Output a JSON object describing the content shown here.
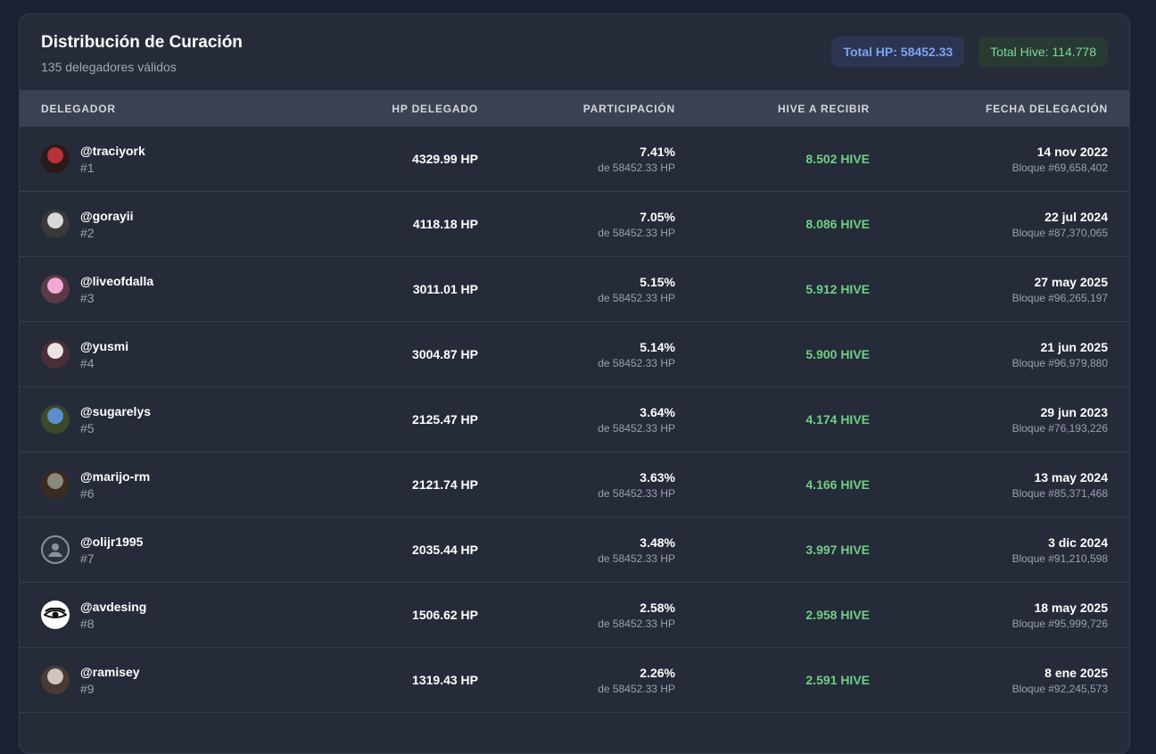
{
  "header": {
    "title": "Distribución de Curación",
    "subtitle": "135 delegadores válidos",
    "total_hp": "Total HP: 58452.33",
    "total_hive": "Total Hive: 114.778"
  },
  "columns": [
    "DELEGADOR",
    "HP DELEGADO",
    "PARTICIPACIÓN",
    "HIVE A RECIBIR",
    "FECHA DELEGACIÓN"
  ],
  "rows": [
    {
      "user": "@traciyork",
      "rank": "#1",
      "hp": "4329.99 HP",
      "pct": "7.41%",
      "pct_sub": "de 58452.33 HP",
      "hive": "8.502 HIVE",
      "date": "14 nov 2022",
      "block": "Bloque #69,658,402",
      "avatar_colors": [
        "#b8323a",
        "#2a1a1a"
      ]
    },
    {
      "user": "@gorayii",
      "rank": "#2",
      "hp": "4118.18 HP",
      "pct": "7.05%",
      "pct_sub": "de 58452.33 HP",
      "hive": "8.086 HIVE",
      "date": "22 jul 2024",
      "block": "Bloque #87,370,065",
      "avatar_colors": [
        "#d8d8d8",
        "#3a3a3a"
      ]
    },
    {
      "user": "@liveofdalla",
      "rank": "#3",
      "hp": "3011.01 HP",
      "pct": "5.15%",
      "pct_sub": "de 58452.33 HP",
      "hive": "5.912 HIVE",
      "date": "27 may 2025",
      "block": "Bloque #96,265,197",
      "avatar_colors": [
        "#f2a9d6",
        "#5a3a46"
      ]
    },
    {
      "user": "@yusmi",
      "rank": "#4",
      "hp": "3004.87 HP",
      "pct": "5.14%",
      "pct_sub": "de 58452.33 HP",
      "hive": "5.900 HIVE",
      "date": "21 jun 2025",
      "block": "Bloque #96,979,880",
      "avatar_colors": [
        "#e9e4e2",
        "#4a2f3a"
      ]
    },
    {
      "user": "@sugarelys",
      "rank": "#5",
      "hp": "2125.47 HP",
      "pct": "3.64%",
      "pct_sub": "de 58452.33 HP",
      "hive": "4.174 HIVE",
      "date": "29 jun 2023",
      "block": "Bloque #76,193,226",
      "avatar_colors": [
        "#5a8fcf",
        "#3b4a2a"
      ]
    },
    {
      "user": "@marijo-rm",
      "rank": "#6",
      "hp": "2121.74 HP",
      "pct": "3.63%",
      "pct_sub": "de 58452.33 HP",
      "hive": "4.166 HIVE",
      "date": "13 may 2024",
      "block": "Bloque #85,371,468",
      "avatar_colors": [
        "#8a8a7a",
        "#3a2a22"
      ]
    },
    {
      "user": "@olijr1995",
      "rank": "#7",
      "hp": "2035.44 HP",
      "pct": "3.48%",
      "pct_sub": "de 58452.33 HP",
      "hive": "3.997 HIVE",
      "date": "3 dic 2024",
      "block": "Bloque #91,210,598",
      "avatar_colors": [
        "#2b313d",
        "#8b919c"
      ]
    },
    {
      "user": "@avdesing",
      "rank": "#8",
      "hp": "1506.62 HP",
      "pct": "2.58%",
      "pct_sub": "de 58452.33 HP",
      "hive": "2.958 HIVE",
      "date": "18 may 2025",
      "block": "Bloque #95,999,726",
      "avatar_colors": [
        "#ffffff",
        "#111111"
      ]
    },
    {
      "user": "@ramisey",
      "rank": "#9",
      "hp": "1319.43 HP",
      "pct": "2.26%",
      "pct_sub": "de 58452.33 HP",
      "hive": "2.591 HIVE",
      "date": "8 ene 2025",
      "block": "Bloque #92,245,573",
      "avatar_colors": [
        "#cfc3bd",
        "#4a3a34"
      ]
    }
  ]
}
